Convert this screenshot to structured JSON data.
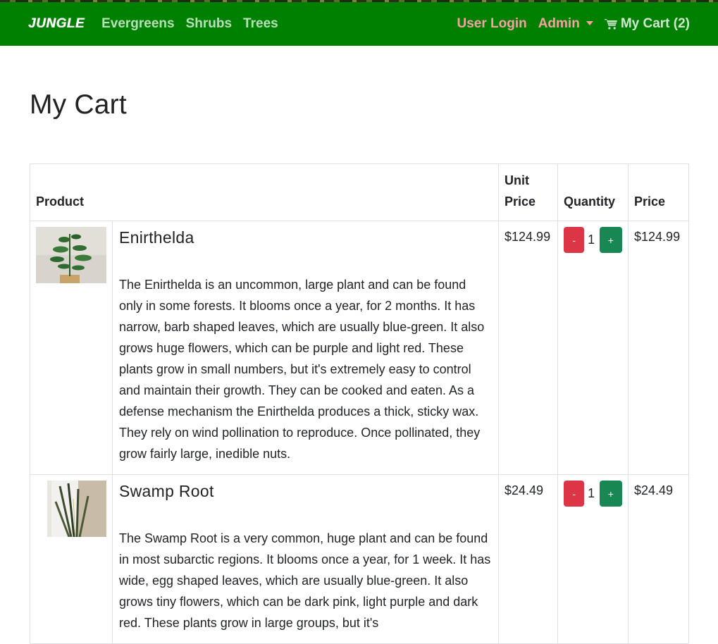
{
  "nav": {
    "brand": "JUNGLE",
    "links": [
      "Evergreens",
      "Shrubs",
      "Trees"
    ],
    "login": "User Login",
    "admin": "Admin",
    "cart": "My Cart (2)",
    "colors": {
      "navbar": "#008000",
      "link": "#b8e0b8",
      "auth": "#f4a2a2"
    }
  },
  "page": {
    "title": "My Cart"
  },
  "table": {
    "headers": {
      "product": "Product",
      "unit_price": "Unit Price",
      "quantity": "Quantity",
      "price": "Price"
    },
    "rows": [
      {
        "name": "Enirthelda",
        "description": "The Enirthelda is an uncommon, large plant and can be found only in some forests. It blooms once a year, for 2 months. It has narrow, barb shaped leaves, which are usually blue-green. It also grows huge flowers, which can be purple and light red. These plants grow in small numbers, but it's extremely easy to control and maintain their growth. They can be cooked and eaten. As a defense mechanism the Enirthelda produces a thick, sticky wax. They rely on wind pollination to reproduce. Once pollinated, they grow fairly large, inedible nuts.",
        "unit_price": "$124.99",
        "minus": "-",
        "quantity": "1",
        "plus": "+",
        "price": "$124.99"
      },
      {
        "name": "Swamp Root",
        "description": "The Swamp Root is a very common, huge plant and can be found in most subarctic regions. It blooms once a year, for 1 week. It has wide, egg shaped leaves, which are usually blue-green. It also grows tiny flowers, which can be dark pink, light purple and dark red. These plants grow in large groups, but it's",
        "unit_price": "$24.49",
        "minus": "-",
        "quantity": "1",
        "plus": "+",
        "price": "$24.49"
      }
    ]
  }
}
